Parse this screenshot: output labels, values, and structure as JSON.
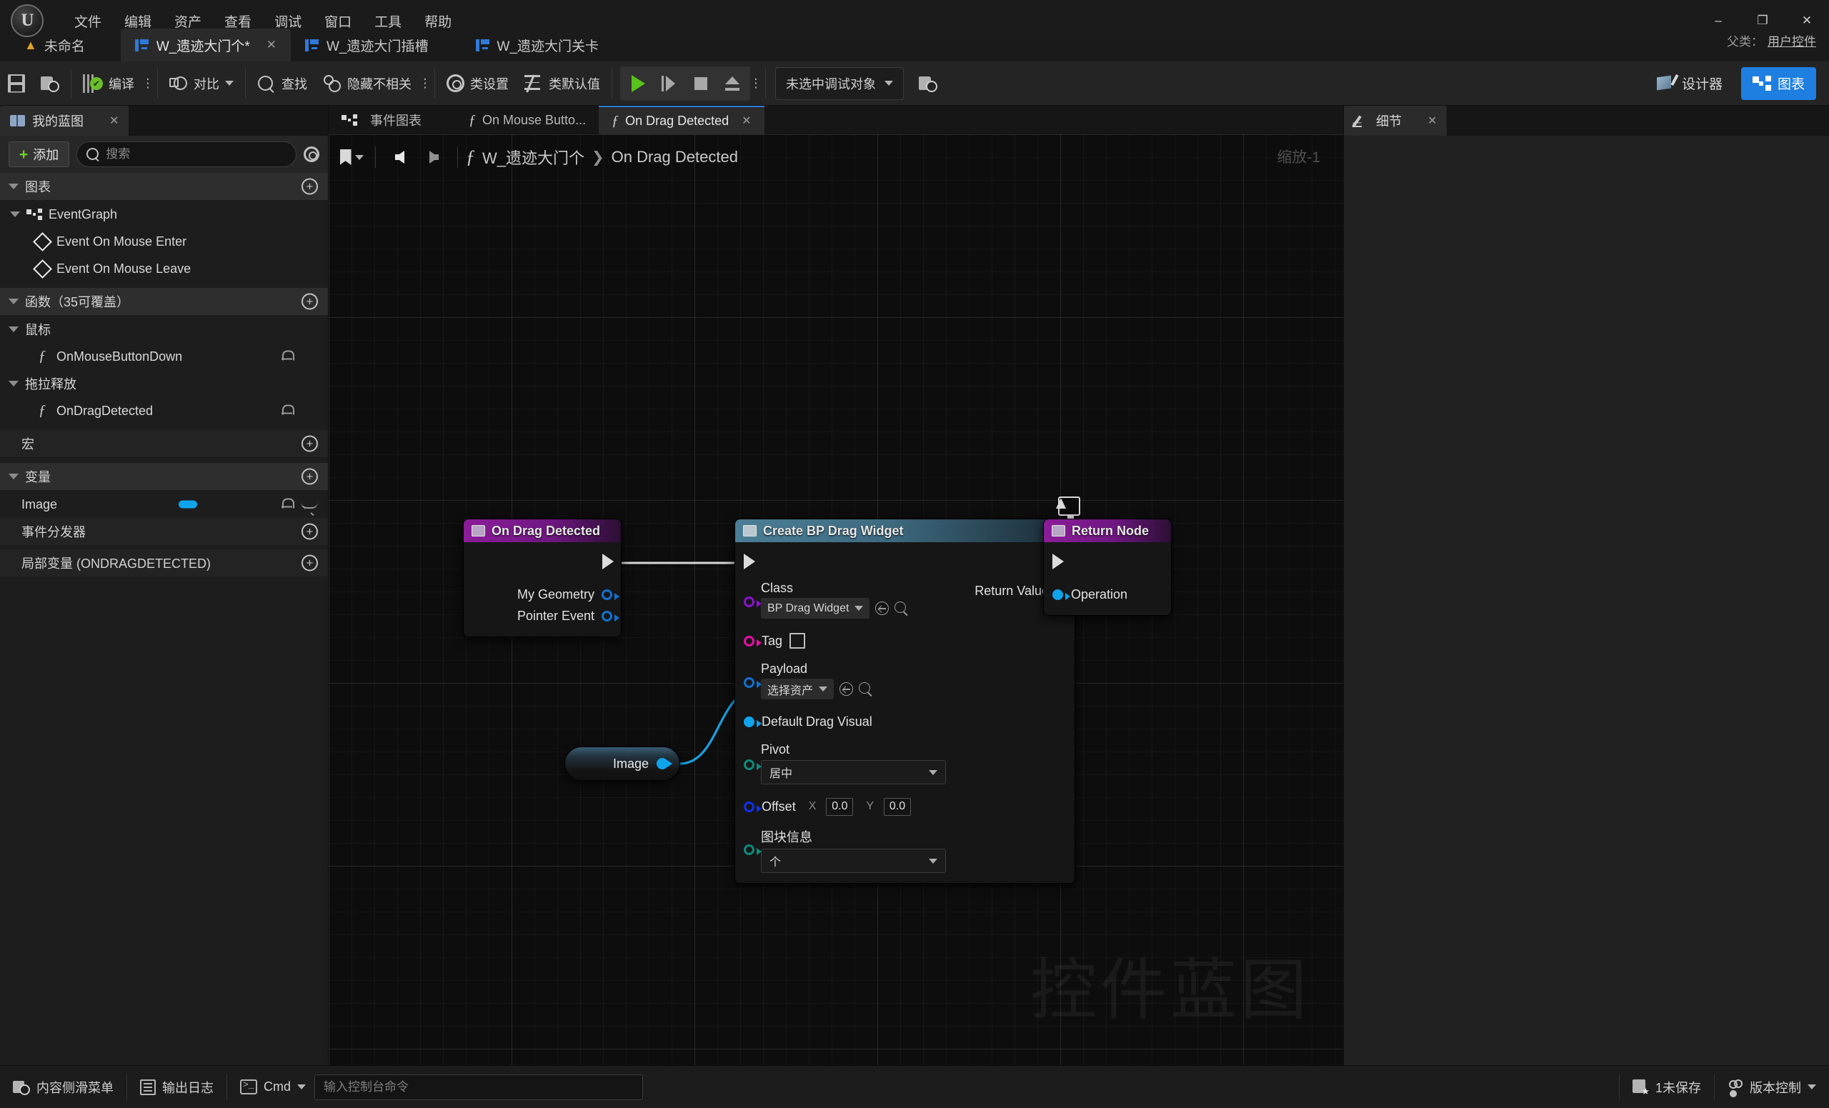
{
  "window": {
    "app": "Unreal Editor",
    "minimize": "–",
    "maximize": "❐",
    "close": "✕"
  },
  "menubar": {
    "items": [
      "文件",
      "编辑",
      "资产",
      "查看",
      "调试",
      "窗口",
      "工具",
      "帮助"
    ]
  },
  "tabs": {
    "project": "未命名",
    "documents": [
      {
        "label": "W_遗迹大门个*",
        "active": true,
        "closable": true
      },
      {
        "label": "W_遗迹大门插槽",
        "active": false,
        "closable": false
      },
      {
        "label": "W_遗迹大门关卡",
        "active": false,
        "closable": false
      }
    ],
    "close_glyph": "✕"
  },
  "parent_class": {
    "label": "父类：",
    "value": "用户控件"
  },
  "toolbar": {
    "save": "",
    "browse": "",
    "compile": "编译",
    "diff": "对比",
    "find": "查找",
    "hide_unrelated": "隐藏不相关",
    "class_settings": "类设置",
    "class_defaults": "类默认值",
    "dots": "⋮",
    "debug_object": "未选中调试对象",
    "designer": "设计器",
    "graph": "图表"
  },
  "my_blueprint": {
    "tab_title": "我的蓝图",
    "close_glyph": "✕",
    "add_label": "添加",
    "search_placeholder": "搜索",
    "search_value": "",
    "sections": [
      {
        "title": "图表",
        "has_add": true
      },
      {
        "title": "函数（35可覆盖）",
        "has_add": true
      },
      {
        "title": "宏",
        "has_add": true
      },
      {
        "title": "变量",
        "has_add": true
      },
      {
        "title": "事件分发器",
        "has_add": true
      },
      {
        "title": "局部变量 (ONDRAGDETECTED)",
        "has_add": true
      }
    ],
    "graph_items": [
      {
        "label": "EventGraph",
        "icon": "graph-icon",
        "indent": 0
      },
      {
        "label": "Event On Mouse Enter",
        "icon": "event-diamond-icon",
        "indent": 1
      },
      {
        "label": "Event On Mouse Leave",
        "icon": "event-diamond-icon",
        "indent": 1
      }
    ],
    "function_groups": [
      {
        "group": "鼠标",
        "items": [
          {
            "label": "OnMouseButtonDown",
            "icon": "function-override-icon"
          }
        ]
      },
      {
        "group": "拖拉释放",
        "items": [
          {
            "label": "OnDragDetected",
            "icon": "function-override-icon"
          }
        ]
      }
    ],
    "variables": [
      {
        "label": "Image",
        "color": "#0fa3ec"
      }
    ]
  },
  "graph_tabs": {
    "items": [
      {
        "label": "事件图表",
        "icon": "graph-icon",
        "active": false,
        "closable": false
      },
      {
        "label": "On Mouse Butto...",
        "icon": "function-icon",
        "active": false,
        "closable": false
      },
      {
        "label": "On Drag Detected",
        "icon": "function-icon",
        "active": true,
        "closable": true
      }
    ],
    "close_glyph": "✕"
  },
  "breadcrumb": {
    "bookmark_icon": "bookmark-icon",
    "back_icon": "arrow-left-icon",
    "forward_icon": "arrow-right-icon",
    "function_glyph": "ƒ",
    "root": "W_遗迹大门个",
    "separator": "❯",
    "current": "On Drag Detected"
  },
  "graph": {
    "zoom_label": "缩放-1",
    "watermark": "控件蓝图",
    "nodes": {
      "event": {
        "title": "On Drag Detected",
        "outputs": [
          "My Geometry",
          "Pointer Event"
        ]
      },
      "create_widget": {
        "title": "Create BP Drag Widget",
        "class_label": "Class",
        "class_value": "BP Drag Widget",
        "tag_label": "Tag",
        "payload_label": "Payload",
        "payload_value": "选择资产",
        "default_drag_visual_label": "Default Drag Visual",
        "pivot_label": "Pivot",
        "pivot_value": "居中",
        "offset_label": "Offset",
        "offset_x_axis": "X",
        "offset_x": "0.0",
        "offset_y_axis": "Y",
        "offset_y": "0.0",
        "tile_info_label": "图块信息",
        "tile_info_value": "个",
        "return_value_label": "Return Value"
      },
      "return": {
        "title": "Return Node",
        "input": "Operation"
      },
      "variable": {
        "label": "Image"
      }
    }
  },
  "details": {
    "tab_title": "细节",
    "close_glyph": "✕"
  },
  "statusbar": {
    "content_drawer": "内容侧滑菜单",
    "output_log": "输出日志",
    "cmd_label": "Cmd",
    "cmd_placeholder": "输入控制台命令",
    "cmd_value": "",
    "unsaved": "1未保存",
    "source_control": "版本控制"
  },
  "colors": {
    "accent": "#1f7fe0",
    "exec_white": "#dcdcdc",
    "object_blue": "#0fa3ec",
    "class_purple": "#8a12cf",
    "name_magenta": "#e80fa5",
    "enum_teal": "#0f8a7a",
    "struct_blue": "#1030e8",
    "compile_green": "#6abf2a"
  }
}
